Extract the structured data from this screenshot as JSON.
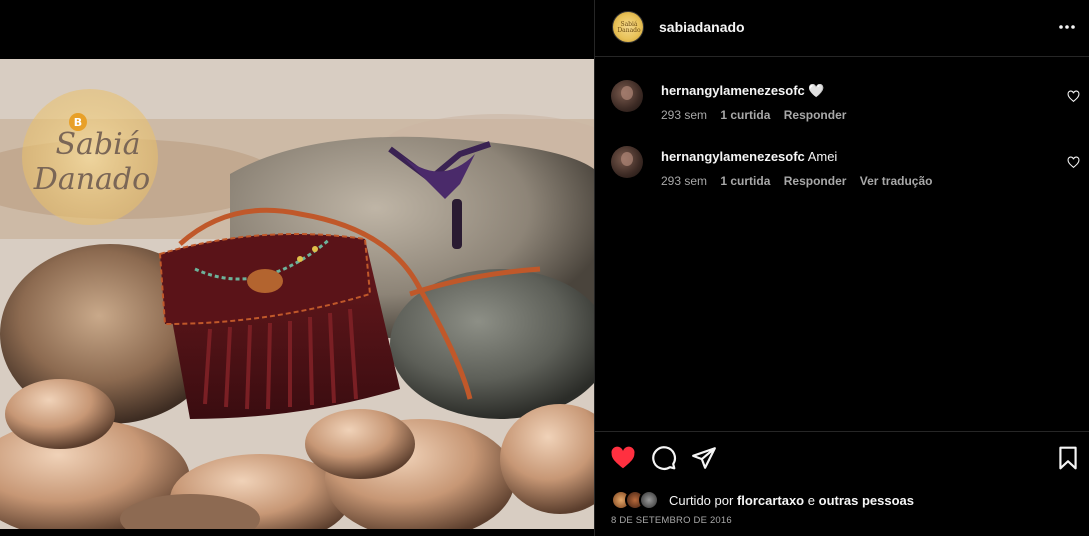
{
  "post": {
    "username": "sabiadanado",
    "more_icon": "more-options-icon",
    "watermark": {
      "line1": "Sabiá",
      "line2": "Danado",
      "badge": "B"
    },
    "header_avatar_text": "Sabiá Danado"
  },
  "comments": [
    {
      "username": "hernangylamenezesofc",
      "text": "🤍",
      "age": "293 sem",
      "likes": "1 curtida",
      "reply": "Responder",
      "translate": ""
    },
    {
      "username": "hernangylamenezesofc",
      "text": "Amei",
      "age": "293 sem",
      "likes": "1 curtida",
      "reply": "Responder",
      "translate": "Ver tradução"
    }
  ],
  "actions": {
    "like_icon": "heart-filled-icon",
    "comment_icon": "comment-icon",
    "share_icon": "share-icon",
    "save_icon": "bookmark-icon",
    "liked_color": "#ff3040"
  },
  "likes": {
    "prefix": "Curtido por",
    "user": "florcartaxo",
    "joiner": "e",
    "others": "outras pessoas"
  },
  "date": "8 DE SETEMBRO DE 2016",
  "colors": {
    "background": "#000000",
    "divider": "#262626",
    "primary_text": "#f5f5f5",
    "secondary_text": "#a8a8a8"
  }
}
